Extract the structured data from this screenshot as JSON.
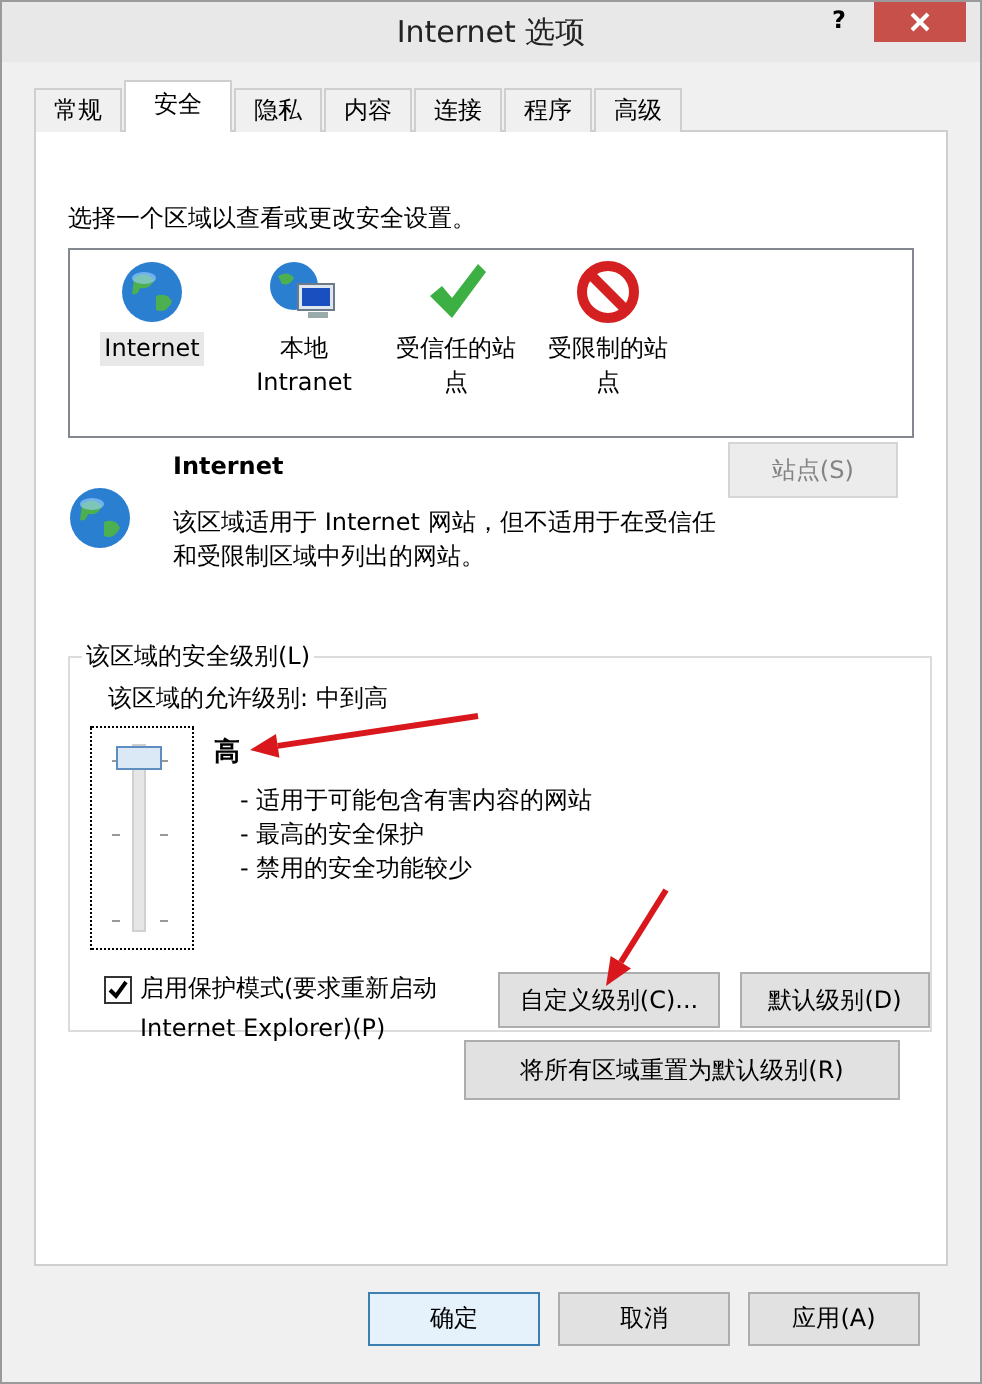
{
  "window": {
    "title": "Internet 选项",
    "help_button": "?"
  },
  "tabs": [
    {
      "label": "常规",
      "selected": false
    },
    {
      "label": "安全",
      "selected": true
    },
    {
      "label": "隐私",
      "selected": false
    },
    {
      "label": "内容",
      "selected": false
    },
    {
      "label": "连接",
      "selected": false
    },
    {
      "label": "程序",
      "selected": false
    },
    {
      "label": "高级",
      "selected": false
    }
  ],
  "security": {
    "prompt": "选择一个区域以查看或更改安全设置。",
    "zones": [
      {
        "label": "Internet",
        "kind": "globe",
        "selected": true
      },
      {
        "label": "本地 Intranet",
        "kind": "intranet",
        "selected": false
      },
      {
        "label": "受信任的站点",
        "kind": "trusted",
        "selected": false
      },
      {
        "label": "受限制的站点",
        "kind": "restricted",
        "selected": false
      }
    ],
    "zone_info": {
      "name": "Internet",
      "description": "该区域适用于 Internet 网站，但不适用于在受信任和受限制区域中列出的网站。"
    },
    "sites_button": {
      "label": "站点(S)",
      "disabled": true
    },
    "level_group": {
      "title": "该区域的安全级别(L)",
      "allowed": "该区域的允许级别: 中到高",
      "level": 1,
      "level_name": "高",
      "bullets": [
        "- 适用于可能包含有害内容的网站",
        "- 最高的安全保护",
        "- 禁用的安全功能较少"
      ],
      "protected_mode": {
        "label": "启用保护模式(要求重新启动 Internet Explorer)(P)",
        "checked": true
      },
      "buttons": [
        "自定义级别(C)...",
        "默认级别(D)"
      ]
    },
    "reset_button": "将所有区域重置为默认级别(R)"
  },
  "footer_buttons": [
    {
      "label": "确定",
      "default": true
    },
    {
      "label": "取消",
      "default": false
    },
    {
      "label": "应用(A)",
      "default": false
    }
  ],
  "annotations": [
    {
      "kind": "arrow"
    },
    {
      "kind": "arrow"
    }
  ]
}
